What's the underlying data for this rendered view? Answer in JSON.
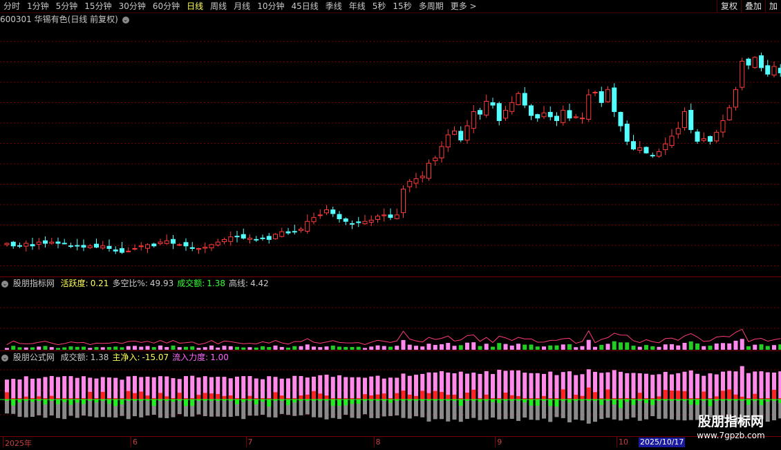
{
  "toolbar": {
    "tabs": [
      "分时",
      "1分钟",
      "5分钟",
      "15分钟",
      "30分钟",
      "60分钟",
      "日线",
      "周线",
      "月线",
      "10分钟",
      "45日线",
      "季线",
      "年线",
      "5秒",
      "15秒",
      "多周期",
      "更多 >"
    ],
    "active": "日线",
    "right_buttons": [
      "复权",
      "叠加",
      "加"
    ]
  },
  "main_header": {
    "code": "600301",
    "name": "华锡有色(日线 前复权)"
  },
  "indicator1": {
    "name": "股朋指标网",
    "items": [
      {
        "label": "活跃度:",
        "value": "0.21",
        "color": "#ffff55"
      },
      {
        "label": "多空比%:",
        "value": "49.93",
        "color": "#c8c8c8"
      },
      {
        "label": "成交额:",
        "value": "1.38",
        "color": "#33ff33"
      },
      {
        "label": "高线:",
        "value": "4.42",
        "color": "#c8c8c8"
      }
    ]
  },
  "indicator2": {
    "name": "股朋公式网",
    "items": [
      {
        "label": "成交额:",
        "value": "1.38",
        "color": "#c8c8c8"
      },
      {
        "label": "主净入:",
        "value": "-15.07",
        "color": "#ffff55"
      },
      {
        "label": "流入力度:",
        "value": "1.00",
        "color": "#ff66ff"
      }
    ]
  },
  "xaxis": {
    "labels": [
      {
        "text": "2025年",
        "bar": 0
      },
      {
        "text": "6",
        "bar": 20
      },
      {
        "text": "7",
        "bar": 38
      },
      {
        "text": "8",
        "bar": 58
      },
      {
        "text": "9",
        "bar": 77
      },
      {
        "text": "10",
        "bar": 96
      }
    ],
    "current_date": "2025/10/17"
  },
  "watermark": {
    "title": "股朋指标网",
    "url": "www.7gpzb.com"
  },
  "colors": {
    "up": "#ff3b3b",
    "down": "#54ffff",
    "grid": "#7a0000",
    "active_tab": "#ffff55"
  },
  "chart_data": {
    "type": "candlestick",
    "closes": [
      13.3,
      13.1,
      13.1,
      13.3,
      13.1,
      13.4,
      13.3,
      13.4,
      13.3,
      13.3,
      13.1,
      13.1,
      13.0,
      13.1,
      13.0,
      13.1,
      12.9,
      12.7,
      12.6,
      12.7,
      12.9,
      13.1,
      13.2,
      13.1,
      13.4,
      13.5,
      13.3,
      13.2,
      13.1,
      12.9,
      12.9,
      13.0,
      13.2,
      13.4,
      13.6,
      13.8,
      13.8,
      13.7,
      13.7,
      13.6,
      13.7,
      13.6,
      14.0,
      14.2,
      14.1,
      14.2,
      14.4,
      15.0,
      15.3,
      15.5,
      15.9,
      15.6,
      15.2,
      15.0,
      14.8,
      14.9,
      15.0,
      15.1,
      15.4,
      15.5,
      15.3,
      15.5,
      17.5,
      18.1,
      18.3,
      18.5,
      19.5,
      19.9,
      20.8,
      21.7,
      22.0,
      21.3,
      22.4,
      23.5,
      23.3,
      24.3,
      24.0,
      22.8,
      23.6,
      24.2,
      24.9,
      24.0,
      23.2,
      23.0,
      23.4,
      23.1,
      22.8,
      23.6,
      23.0,
      23.1,
      23.0,
      24.8,
      25.0,
      24.2,
      25.2,
      23.5,
      22.4,
      21.2,
      20.6,
      20.7,
      20.3,
      20.1,
      20.4,
      21.0,
      21.6,
      22.2,
      23.5,
      22.1,
      21.2,
      21.4,
      21.2,
      21.9,
      22.8,
      23.8,
      25.2,
      27.4,
      27.1,
      27.7,
      26.9,
      26.4,
      27.0,
      26.5
    ]
  }
}
